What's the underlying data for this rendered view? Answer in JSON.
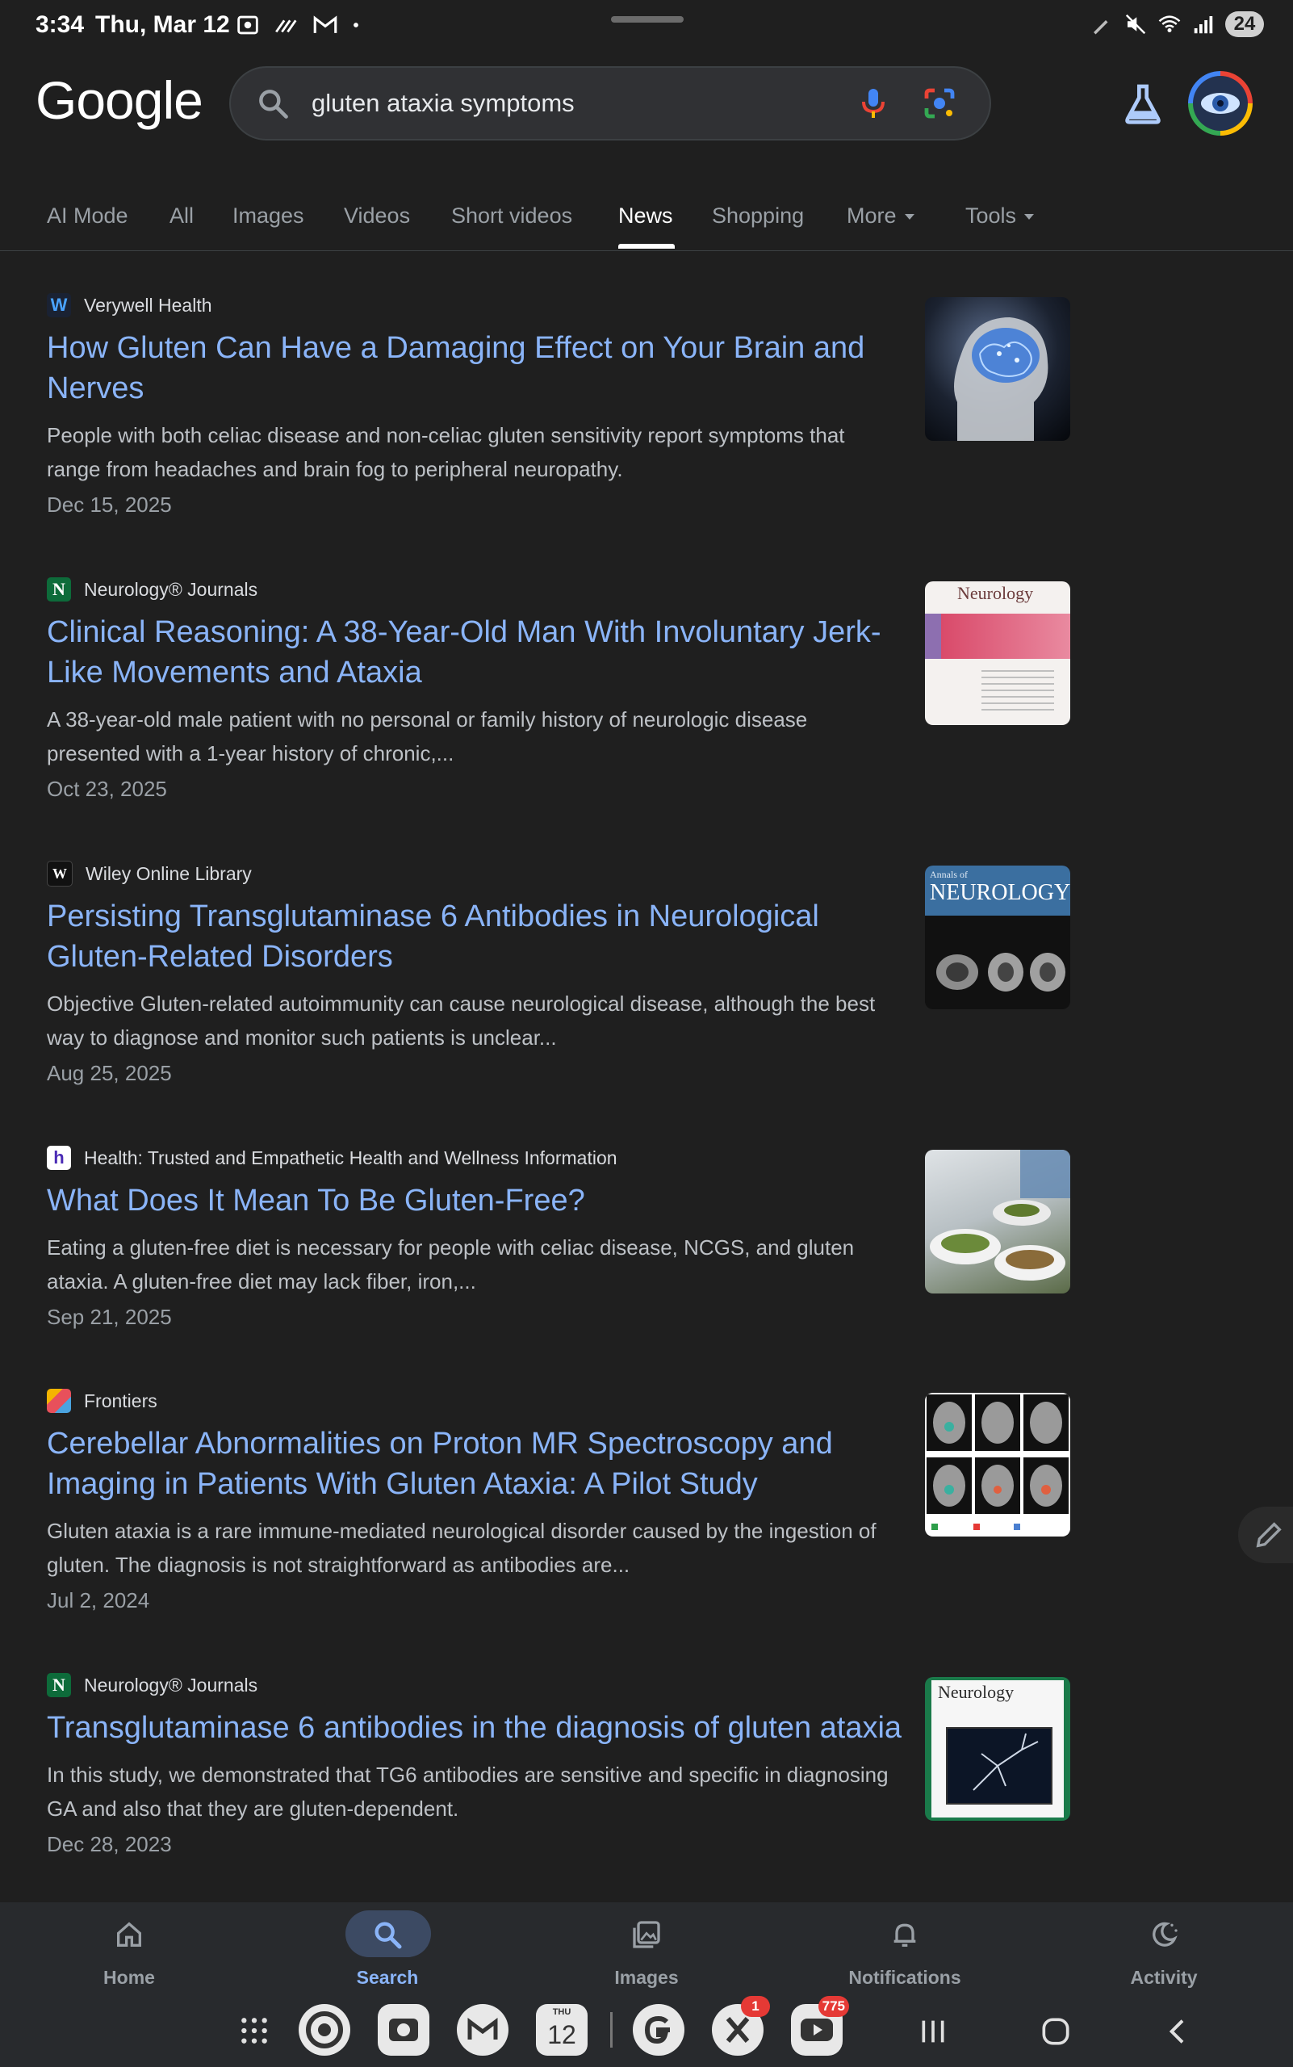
{
  "status_bar": {
    "time": "3:34",
    "date": "Thu, Mar 12",
    "battery": "24"
  },
  "logo": "Google",
  "search": {
    "query": "gluten ataxia symptoms"
  },
  "tabs": [
    {
      "label": "AI Mode"
    },
    {
      "label": "All"
    },
    {
      "label": "Images"
    },
    {
      "label": "Videos"
    },
    {
      "label": "Short videos"
    },
    {
      "label": "News"
    },
    {
      "label": "Shopping"
    },
    {
      "label": "More"
    },
    {
      "label": "Tools"
    }
  ],
  "active_tab": "News",
  "results": [
    {
      "source": "Verywell Health",
      "favicon": "W",
      "title": "How Gluten Can Have a Damaging Effect on Your Brain and Nerves",
      "snippet": "People with both celiac disease and non-celiac gluten sensitivity report symptoms that range from headaches and brain fog to peripheral neuropathy.",
      "date": "Dec 15, 2025",
      "thumbnail": "brain-image"
    },
    {
      "source": "Neurology® Journals",
      "favicon": "N",
      "title": "Clinical Reasoning: A 38-Year-Old Man With Involuntary Jerk-Like Movements and Ataxia",
      "snippet": "A 38-year-old male patient with no personal or family history of neurologic disease presented with a 1-year history of chronic,...",
      "date": "Oct 23, 2025",
      "thumbnail": "neurology-journal-cover",
      "thumb_text": "Neurology"
    },
    {
      "source": "Wiley Online Library",
      "favicon": "W",
      "title": "Persisting Transglutaminase 6 Antibodies in Neurological Gluten-Related Disorders",
      "snippet": "Objective Gluten-related autoimmunity can cause neurological disease, although the best way to diagnose and monitor such patients is unclear...",
      "date": "Aug 25, 2025",
      "thumbnail": "annals-of-neurology-cover",
      "thumb_text_small": "Annals of",
      "thumb_text": "NEUROLOGY"
    },
    {
      "source": "Health: Trusted and Empathetic Health and Wellness Information",
      "favicon": "h",
      "title": "What Does It Mean To Be Gluten-Free?",
      "snippet": "Eating a gluten-free diet is necessary for people with celiac disease, NCGS, and gluten ataxia. A gluten-free diet may lack fiber, iron,...",
      "date": "Sep 21, 2025",
      "thumbnail": "food-plates-photo"
    },
    {
      "source": "Frontiers",
      "favicon": "F",
      "title": "Cerebellar Abnormalities on Proton MR Spectroscopy and Imaging in Patients With Gluten Ataxia: A Pilot Study",
      "snippet": "Gluten ataxia is a rare immune-mediated neurological disorder caused by the ingestion of gluten. The diagnosis is not straightforward as antibodies are...",
      "date": "Jul 2, 2024",
      "thumbnail": "mri-scans-grid"
    },
    {
      "source": "Neurology® Journals",
      "favicon": "N",
      "title": "Transglutaminase 6 antibodies in the diagnosis of gluten ataxia",
      "snippet": "In this study, we demonstrated that TG6 antibodies are sensitive and specific in diagnosing GA and also that they are gluten-dependent.",
      "date": "Dec 28, 2023",
      "thumbnail": "neurology-green-cover",
      "thumb_text": "Neurology"
    }
  ],
  "bottom_nav": [
    {
      "label": "Home",
      "icon": "home-icon"
    },
    {
      "label": "Search",
      "icon": "search-icon"
    },
    {
      "label": "Images",
      "icon": "images-icon"
    },
    {
      "label": "Notifications",
      "icon": "bell-icon"
    },
    {
      "label": "Activity",
      "icon": "activity-icon"
    }
  ],
  "active_nav": "Search",
  "dock": {
    "calendar_day": "THU",
    "calendar_date": "12",
    "x_badge": "1",
    "youtube_badge": "775"
  },
  "colors": {
    "background": "#1f1f1f",
    "link": "#8ab4f8",
    "snippet": "#bdc1c6"
  }
}
